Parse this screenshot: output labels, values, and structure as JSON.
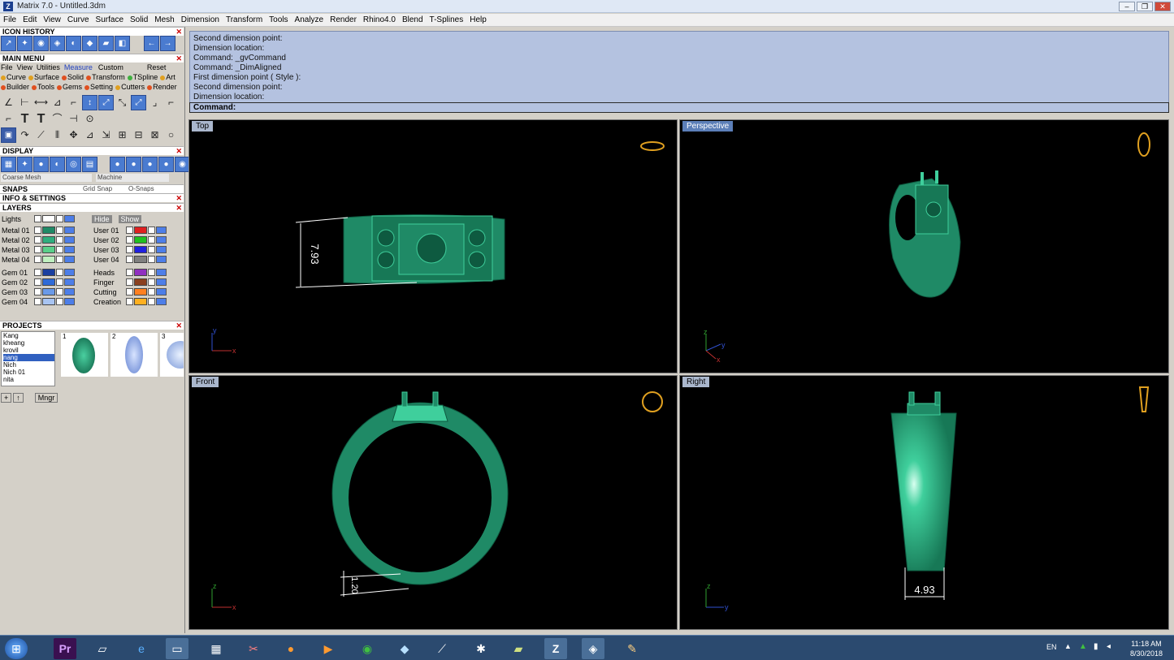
{
  "window": {
    "title": "Matrix 7.0 - Untitled.3dm",
    "app_icon": "Z"
  },
  "menu": [
    "File",
    "Edit",
    "View",
    "Curve",
    "Surface",
    "Solid",
    "Mesh",
    "Dimension",
    "Transform",
    "Tools",
    "Analyze",
    "Render",
    "Rhino4.0",
    "Blend",
    "T-Splines",
    "Help"
  ],
  "panel": {
    "icon_history": "ICON HISTORY",
    "main_menu": "MAIN MENU",
    "main_tabs": [
      "File",
      "View",
      "Utilities",
      "Measure",
      "Custom",
      "Reset"
    ],
    "row1": [
      "Curve",
      "Surface",
      "Solid",
      "Transform",
      "TSpline",
      "Art"
    ],
    "row2": [
      "Builder",
      "Tools",
      "Gems",
      "Setting",
      "Cutters",
      "Render"
    ],
    "display": "DISPLAY",
    "display_mode": "Coarse Mesh",
    "material": "Machine",
    "snaps": "SNAPS",
    "grid_snap": "Grid Snap",
    "o_snaps": "O-Snaps",
    "info": "INFO & SETTINGS",
    "layers": "LAYERS",
    "lights": "Lights",
    "hide": "Hide",
    "show": "Show",
    "layers_left": [
      "Metal 01",
      "Metal 02",
      "Metal 03",
      "Metal 04",
      "Gem 01",
      "Gem 02",
      "Gem 03",
      "Gem 04"
    ],
    "layers_right": [
      "User 01",
      "User 02",
      "User 03",
      "User 04",
      "Heads",
      "Finger",
      "Cutting",
      "Creation"
    ],
    "projects": "PROJECTS",
    "project_list": [
      "Kang",
      "kheang",
      "krovil",
      "nang",
      "Nich",
      "Nich 01",
      "nita"
    ],
    "thumbs": [
      "1",
      "2",
      "3"
    ],
    "mngr": "Mngr"
  },
  "command": {
    "history": [
      "Second dimension point:",
      "Dimension location:",
      "Command: _gvCommand",
      "Command: _DimAligned",
      "First dimension point ( Style ):",
      "Second dimension point:",
      "Dimension location:"
    ],
    "prompt": "Command:"
  },
  "viewports": {
    "top": "Top",
    "perspective": "Perspective",
    "front": "Front",
    "right": "Right"
  },
  "dims": {
    "top": "7.93",
    "front": "1.20",
    "right": "4.93"
  },
  "axes": {
    "x": "x",
    "y": "y",
    "z": "z"
  },
  "taskbar": {
    "lang": "EN",
    "time": "11:18 AM",
    "date": "8/30/2018"
  },
  "colors": {
    "ring": "#1f8a66",
    "ring_dark": "#0e5a40",
    "ring_light": "#3fcf9c",
    "cmd_bg": "#b4c2e0"
  }
}
